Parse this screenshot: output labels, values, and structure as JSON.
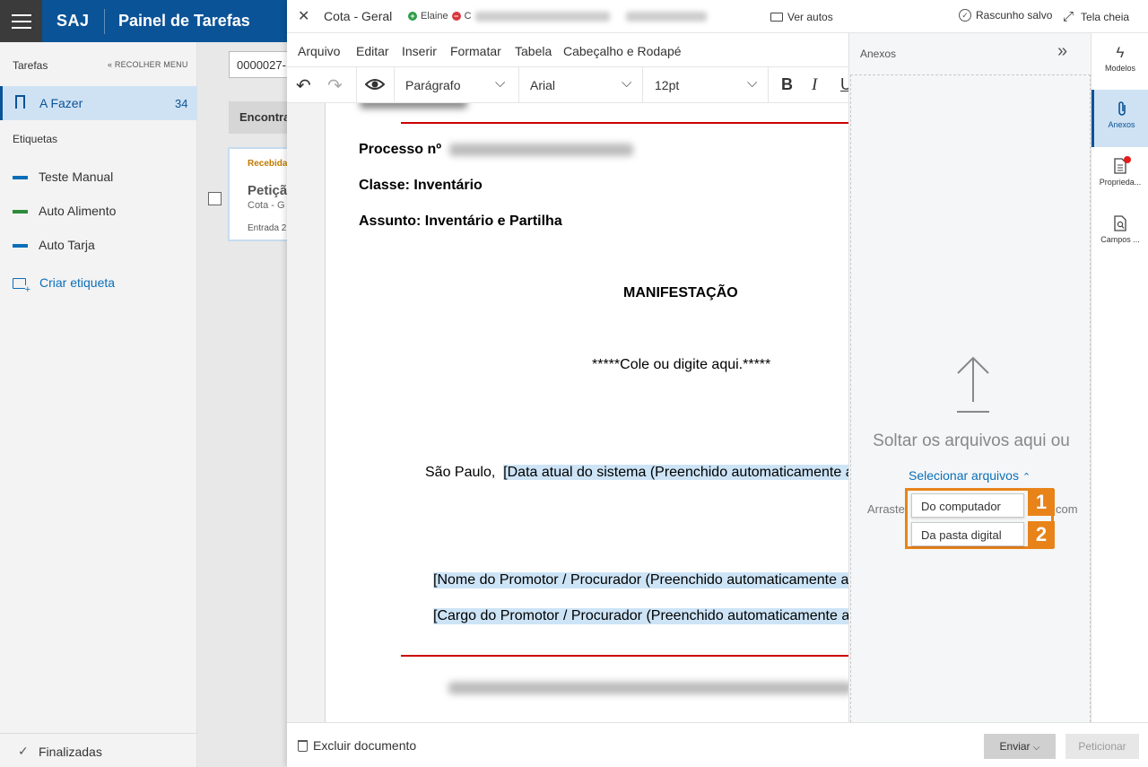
{
  "app": {
    "brand": "SAJ",
    "title": "Painel de Tarefas"
  },
  "sidebar": {
    "heading": "Tarefas",
    "collapse_label": "RECOLHER MENU",
    "afazer": {
      "label": "A Fazer",
      "count": "34"
    },
    "etiquetas_heading": "Etiquetas",
    "tags": [
      {
        "label": "Teste Manual",
        "color": "#0b6fb8"
      },
      {
        "label": "Auto Alimento",
        "color": "#2e8b3a"
      },
      {
        "label": "Auto Tarja",
        "color": "#0b6fb8"
      }
    ],
    "create_tag": "Criar etiqueta",
    "footer": "Finalizadas"
  },
  "main": {
    "search_value": "0000027-",
    "encontr": "Encontra",
    "card": {
      "status": "Recebida",
      "title": "Petição",
      "subtitle": "Cota - G",
      "entrada": "Entrada 2"
    }
  },
  "editor": {
    "close_icon": "close-icon",
    "title": "Cota - Geral",
    "user": "Elaine",
    "user2_initial": "C",
    "ver_autos": "Ver autos",
    "rascunho": "Rascunho salvo",
    "tela_cheia": "Tela cheia",
    "menu": [
      "Arquivo",
      "Editar",
      "Inserir",
      "Formatar",
      "Tabela",
      "Cabeçalho e Rodapé"
    ],
    "toolbar": {
      "paragraph": "Parágrafo",
      "font": "Arial",
      "size": "12pt"
    },
    "document": {
      "processo_label": "Processo nº",
      "classe": "Classe:  Inventário",
      "assunto": "Assunto:  Inventário e Partilha",
      "heading": "MANIFESTAÇÃO",
      "placeholder": "*****Cole ou digite aqui.*****",
      "city": "São Paulo,",
      "date_field": "[Data atual do sistema (Preenchido automaticamente a",
      "promotor_name": "[Nome do Promotor / Procurador (Preenchido automaticamente a",
      "promotor_cargo": "[Cargo do Promotor / Procurador (Preenchido automaticamente a"
    },
    "footer": {
      "excluir": "Excluir documento",
      "enviar": "Enviar",
      "peticionar": "Peticionar"
    }
  },
  "anexos": {
    "title": "Anexos",
    "drop_text": "Soltar os arquivos aqui ou",
    "select_files": "Selecionar arquivos",
    "arraste": "Arraste",
    "arraste_tail": "com",
    "options": [
      "Do computador",
      "Da pasta digital"
    ],
    "badges": [
      "1",
      "2"
    ],
    "highlight_color": "#e8831a"
  },
  "rail": [
    {
      "label": "Modelos",
      "icon": "lightning-icon"
    },
    {
      "label": "Anexos",
      "icon": "paperclip-icon",
      "active": true
    },
    {
      "label": "Proprieda...",
      "icon": "document-properties-icon",
      "notification": true
    },
    {
      "label": "Campos ...",
      "icon": "document-search-icon"
    }
  ]
}
